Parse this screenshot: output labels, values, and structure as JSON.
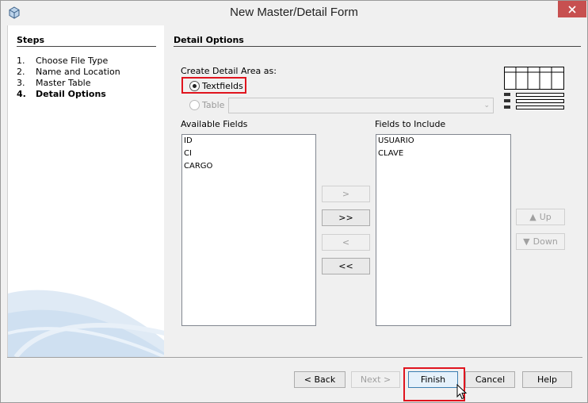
{
  "window": {
    "title": "New Master/Detail Form",
    "close_icon": "close-icon",
    "app_icon": "netbeans-cube-icon"
  },
  "steps": {
    "title": "Steps",
    "items": [
      {
        "num": "1.",
        "label": "Choose File Type"
      },
      {
        "num": "2.",
        "label": "Name and Location"
      },
      {
        "num": "3.",
        "label": "Master Table"
      },
      {
        "num": "4.",
        "label": "Detail Options"
      }
    ],
    "active_index": 3
  },
  "content": {
    "title": "Detail Options",
    "create_detail_label": "Create Detail Area as:",
    "option_textfields": "Textfields",
    "option_table": "Table",
    "table_dropdown_value": "",
    "available_label": "Available Fields",
    "include_label": "Fields to Include",
    "available_fields": [
      "ID",
      "CI",
      "CARGO"
    ],
    "include_fields": [
      "USUARIO",
      "CLAVE"
    ],
    "move_buttons": {
      "add": ">",
      "add_all": ">>",
      "remove": "<",
      "remove_all": "<<"
    },
    "order_buttons": {
      "up": "Up",
      "down": "Down"
    }
  },
  "footer": {
    "back": "< Back",
    "next": "Next >",
    "finish": "Finish",
    "cancel": "Cancel",
    "help": "Help"
  },
  "colors": {
    "highlight": "#e0141e",
    "close": "#c75050"
  }
}
